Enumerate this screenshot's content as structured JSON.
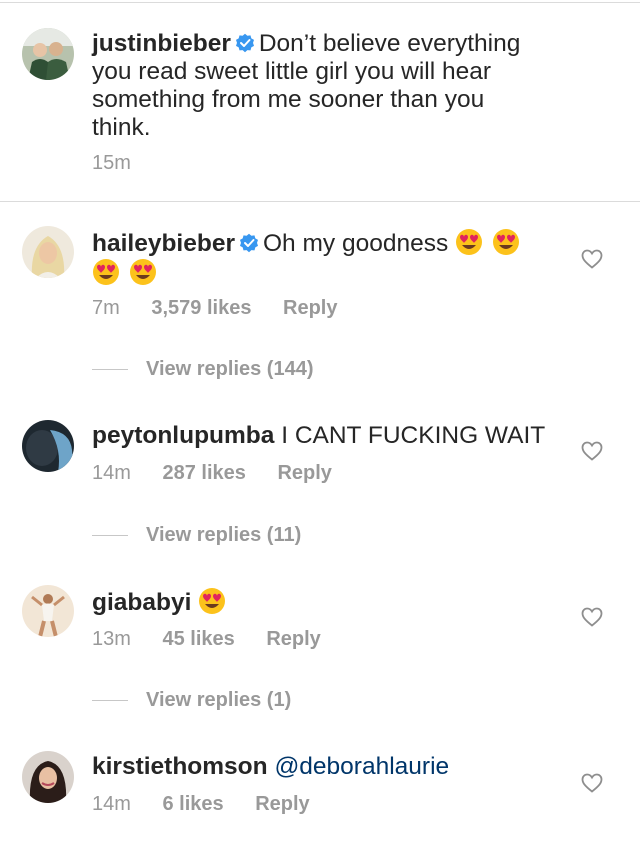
{
  "caption": {
    "username": "justinbieber",
    "text": "Don’t believe everything you read sweet little girl you will hear something from me sooner than you think.",
    "time": "15m",
    "verified_icon": "verified-badge-icon"
  },
  "comments": [
    {
      "username": "haileybieber",
      "text": "Oh my goodness",
      "emoji": "heart-eyes-emoji",
      "time": "7m",
      "likes": "3,579 likes",
      "reply": "Reply",
      "view_replies": "View replies (144)"
    },
    {
      "username": "peytonlupumba",
      "text": "I CANT FUCKING WAIT",
      "time": "14m",
      "likes": "287 likes",
      "reply": "Reply",
      "view_replies": "View replies (11)"
    },
    {
      "username": "giababyi",
      "text": "",
      "emoji": "heart-eyes-emoji",
      "time": "13m",
      "likes": "45 likes",
      "reply": "Reply",
      "view_replies": "View replies (1)"
    },
    {
      "username": "kirstiethomson",
      "text": "@deborahlaurie",
      "time": "14m",
      "likes": "6 likes",
      "reply": "Reply"
    }
  ],
  "colors": {
    "verified": "#3897f0",
    "text": "#262626",
    "muted": "#999999",
    "mention": "#003569"
  }
}
